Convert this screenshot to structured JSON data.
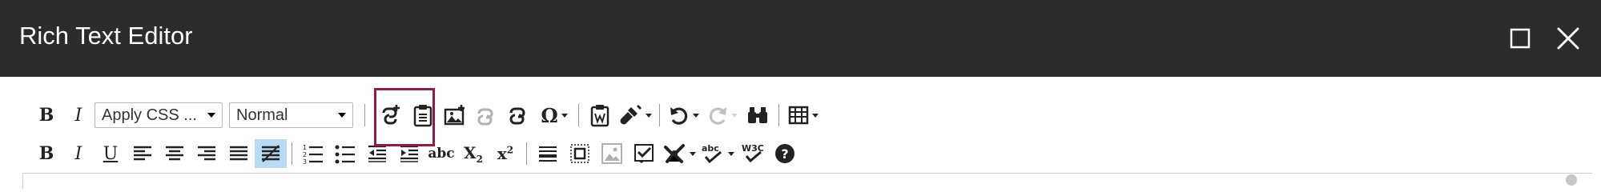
{
  "window": {
    "title": "Rich Text Editor",
    "maximize_icon": "maximize-icon",
    "close_icon": "close-icon"
  },
  "toolbar": {
    "row1": {
      "bold_label": "B",
      "italic_label": "I",
      "css_select": {
        "value": "Apply CSS ..."
      },
      "format_select": {
        "value": "Normal"
      },
      "special_char_label": "Ω",
      "buttons": [
        "insert-link-icon",
        "paste-icon",
        "insert-image-icon",
        "link-icon",
        "unlink-icon",
        "special-character-icon",
        "paste-from-word-icon",
        "format-painter-icon",
        "undo-icon",
        "redo-icon",
        "find-icon",
        "table-icon"
      ],
      "highlighted": "insert-link-icon"
    },
    "row2": {
      "bold_label": "B",
      "italic_label": "I",
      "underline_label": "U",
      "strike_label": "abc",
      "subscript_label": "X",
      "subscript_suffix": "2",
      "superscript_label": "x",
      "superscript_suffix": "2",
      "active": "strike-all-icon",
      "buttons": [
        "align-left-icon",
        "align-center-icon",
        "align-right-icon",
        "justify-icon",
        "strike-all-icon",
        "ordered-list-icon",
        "unordered-list-icon",
        "outdent-icon",
        "indent-icon",
        "strikethrough-icon",
        "subscript-icon",
        "superscript-icon",
        "horizontal-rule-icon",
        "select-all-icon",
        "image-placeholder-icon",
        "form-check-icon",
        "wrench-icon",
        "spellcheck-icon",
        "w3c-validate-icon",
        "help-icon"
      ]
    }
  },
  "colors": {
    "titlebar_bg": "#2c2c2c",
    "title_text": "#ffffff",
    "highlight_border": "#8e1b4a",
    "active_button_bg": "#b6dbf3"
  }
}
